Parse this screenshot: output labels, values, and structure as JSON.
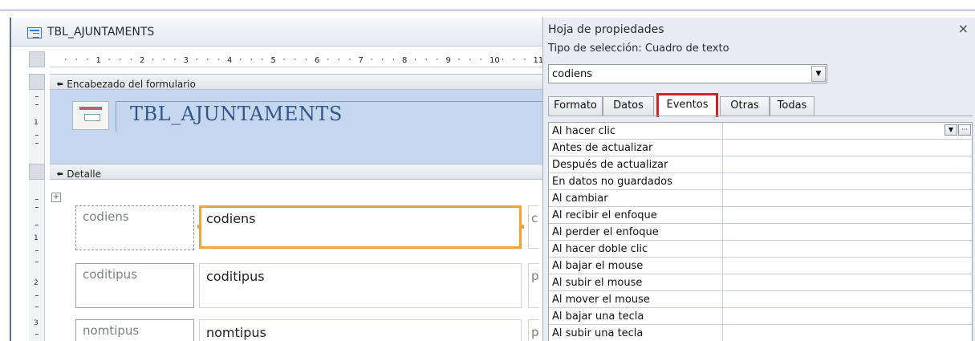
{
  "form_window": {
    "title": "TBL_AJUNTAMENTS",
    "ruler_numbers": [
      "1",
      "2",
      "3",
      "4",
      "5",
      "6",
      "7",
      "8",
      "9",
      "10",
      "11"
    ],
    "vertical_ruler_numbers": [
      "1",
      "2",
      "3"
    ],
    "header_section_label": "Encabezado del formulario",
    "header_title": "TBL_AJUNTAMENTS",
    "detail_section_label": "Detalle",
    "fields": [
      {
        "label": "codiens",
        "value": "codiens",
        "cut": "c"
      },
      {
        "label": "coditipus",
        "value": "coditipus",
        "cut": "p"
      },
      {
        "label": "nomtipus",
        "value": "nomtipus",
        "cut": "p"
      }
    ],
    "section_icon": "section-arrow-icon",
    "accent_color": "#f2a43a",
    "header_bg": "#c5d7ee"
  },
  "property_sheet": {
    "title": "Hoja de propiedades",
    "close_glyph": "×",
    "selection_type": "Tipo de selección:  Cuadro de texto",
    "selected_object": "codiens",
    "dropdown_glyph": "▼",
    "builder_glyph": "···",
    "tabs": [
      "Formato",
      "Datos",
      "Eventos",
      "Otras",
      "Todas"
    ],
    "active_tab": "Eventos",
    "highlight_color": "#d61f26",
    "properties": [
      "Al hacer clic",
      "Antes de actualizar",
      "Después de actualizar",
      "En datos no guardados",
      "Al cambiar",
      "Al recibir el enfoque",
      "Al perder el enfoque",
      "Al hacer doble clic",
      "Al bajar el mouse",
      "Al subir el mouse",
      "Al mover el mouse",
      "Al bajar una tecla",
      "Al subir una tecla"
    ]
  }
}
